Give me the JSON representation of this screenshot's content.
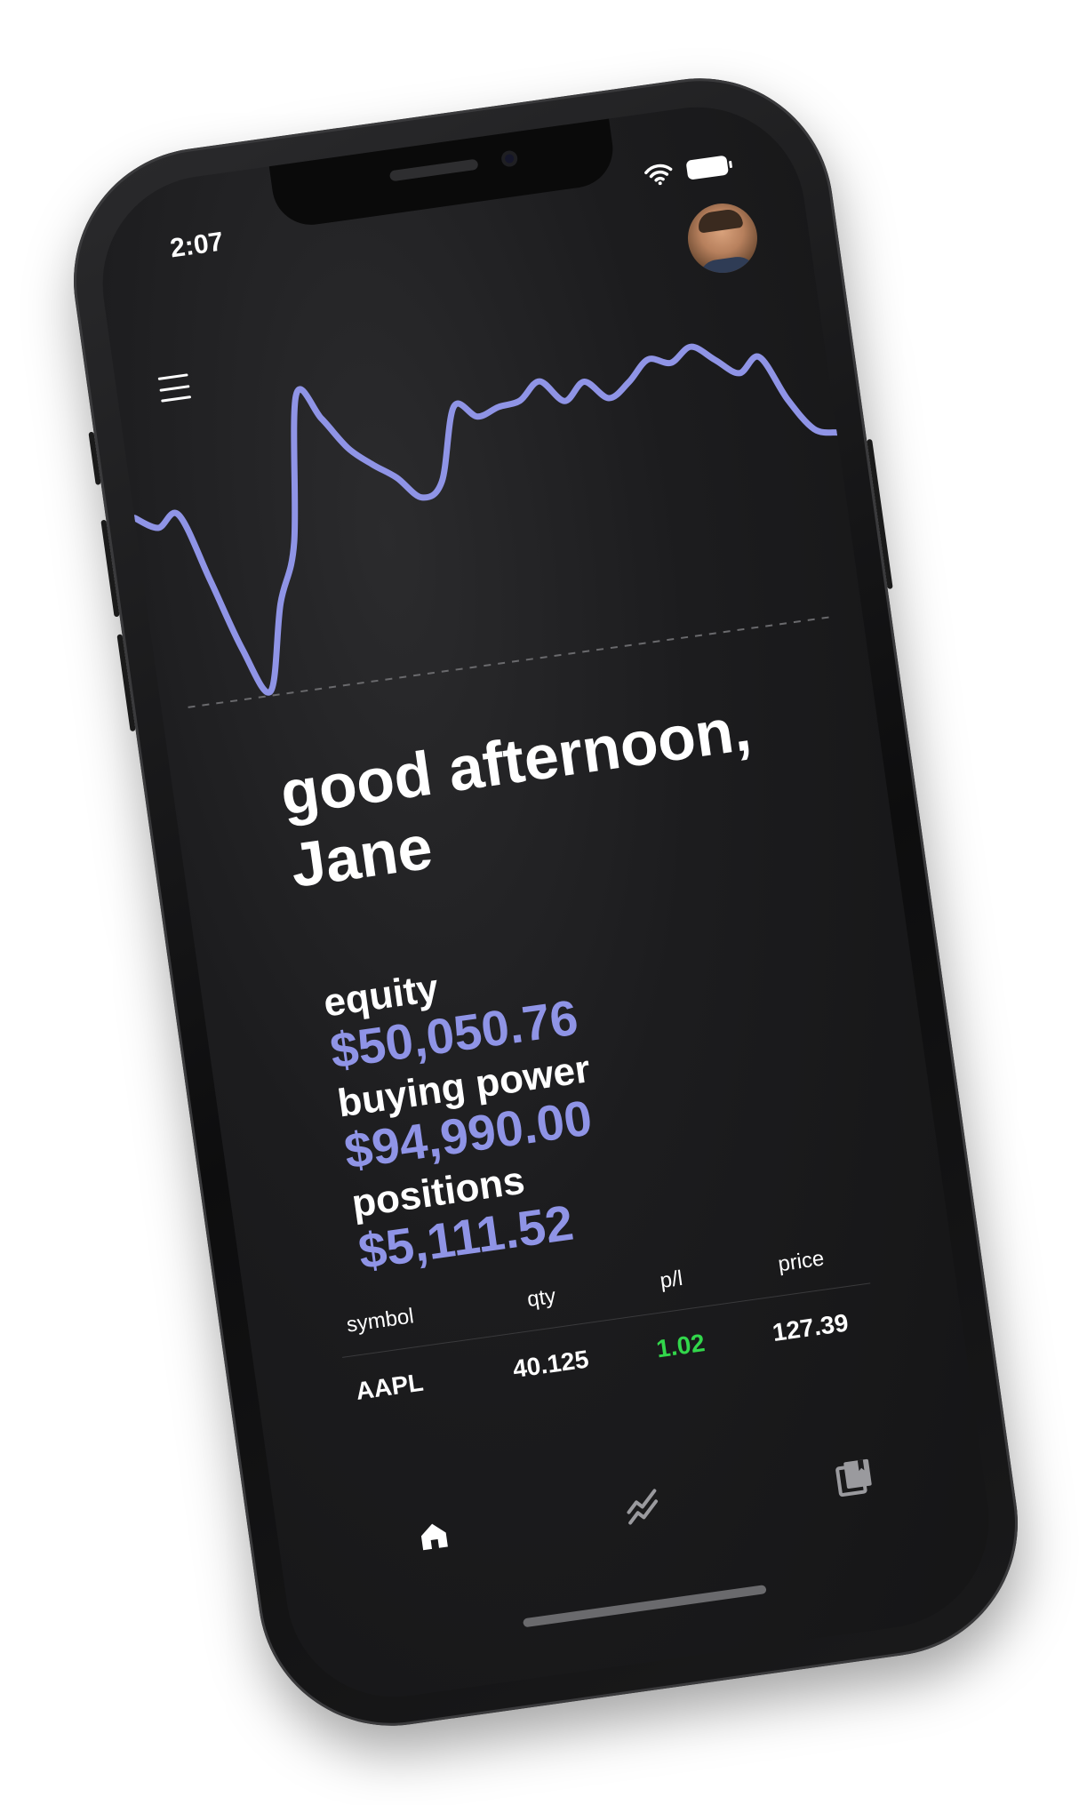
{
  "status_bar": {
    "time": "2:07",
    "wifi_icon": "wifi-icon",
    "battery_icon": "battery-icon"
  },
  "header": {
    "menu_icon": "hamburger-menu-icon",
    "avatar": "user-avatar"
  },
  "chart_data": {
    "type": "line",
    "color": "#8f94e6",
    "baseline_style": "dashed",
    "x": [
      0,
      1,
      2,
      3,
      4,
      5,
      6,
      7,
      8,
      9,
      10,
      11,
      12,
      13,
      14,
      15,
      16,
      17,
      18,
      19,
      20,
      21,
      22,
      23,
      24,
      25,
      26,
      27,
      28,
      29,
      30,
      31,
      32,
      33,
      34,
      35,
      36,
      37,
      38,
      39,
      40
    ],
    "values": [
      62,
      58,
      61,
      40,
      18,
      4,
      30,
      48,
      92,
      84,
      74,
      68,
      63,
      56,
      60,
      82,
      78,
      80,
      81,
      86,
      79,
      84,
      78,
      82,
      88,
      86,
      90,
      85,
      80,
      84,
      70,
      60,
      58
    ]
  },
  "greeting": {
    "line1": "good afternoon,",
    "line2": "Jane"
  },
  "account": {
    "equity_label": "equity",
    "equity_value": "$50,050.76",
    "buying_power_label": "buying power",
    "buying_power_value": "$94,990.00",
    "positions_label": "positions",
    "positions_value": "$5,111.52"
  },
  "positions_table": {
    "headers": [
      "symbol",
      "qty",
      "p/l",
      "price"
    ],
    "rows": [
      {
        "symbol": "AAPL",
        "qty": "40.125",
        "pl": "1.02",
        "price": "127.39"
      }
    ]
  },
  "tabbar": {
    "home_icon": "home-icon",
    "trends_icon": "trending-icon",
    "library_icon": "library-icon"
  },
  "colors": {
    "accent": "#8f94e6",
    "positive": "#32d74b",
    "background": "#1c1c1e"
  }
}
